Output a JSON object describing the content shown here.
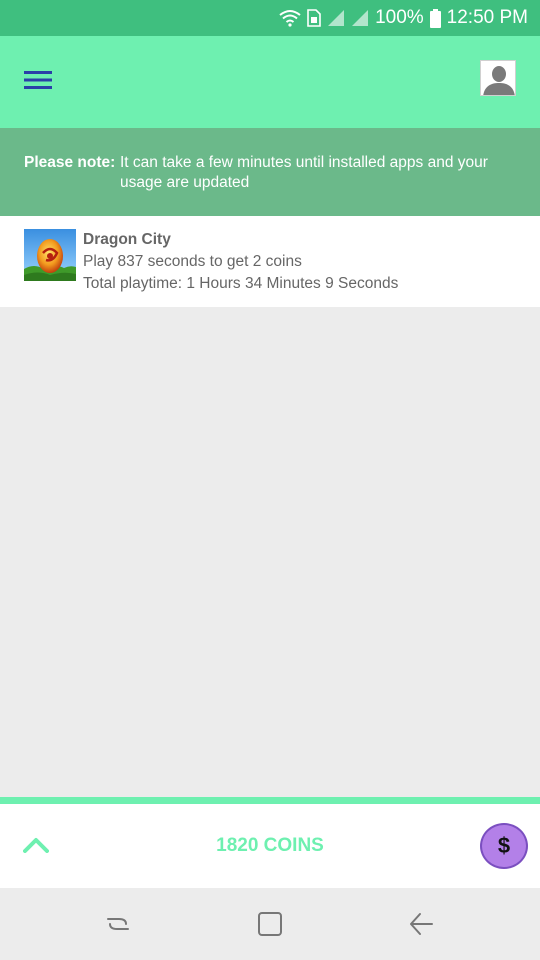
{
  "status_bar": {
    "battery": "100%",
    "time": "12:50 PM",
    "icons": [
      "wifi-icon",
      "sim-icon",
      "signal-icon",
      "signal-icon",
      "battery-icon"
    ]
  },
  "app_bar": {
    "menu_icon": "hamburger-menu-icon",
    "profile_icon": "user-avatar-icon"
  },
  "notice": {
    "label": "Please note:",
    "text": "It can take a few minutes until installed apps and your usage are updated"
  },
  "apps": [
    {
      "name": "Dragon City",
      "goal": "Play 837 seconds to get 2 coins",
      "playtime": "Total playtime: 1 Hours 34 Minutes 9 Seconds"
    }
  ],
  "coins_bar": {
    "label": "1820 COINS",
    "coin_symbol": "$",
    "expand_icon": "chevron-up-icon"
  },
  "nav_bar": {
    "icons": [
      "recent-apps-icon",
      "home-icon",
      "back-icon"
    ]
  },
  "colors": {
    "status_bar": "#3fbf7f",
    "accent": "#6ef0b0",
    "notice_bg": "#6bb98a",
    "menu_icon": "#2a3fa8",
    "coin": "#b380e8"
  }
}
